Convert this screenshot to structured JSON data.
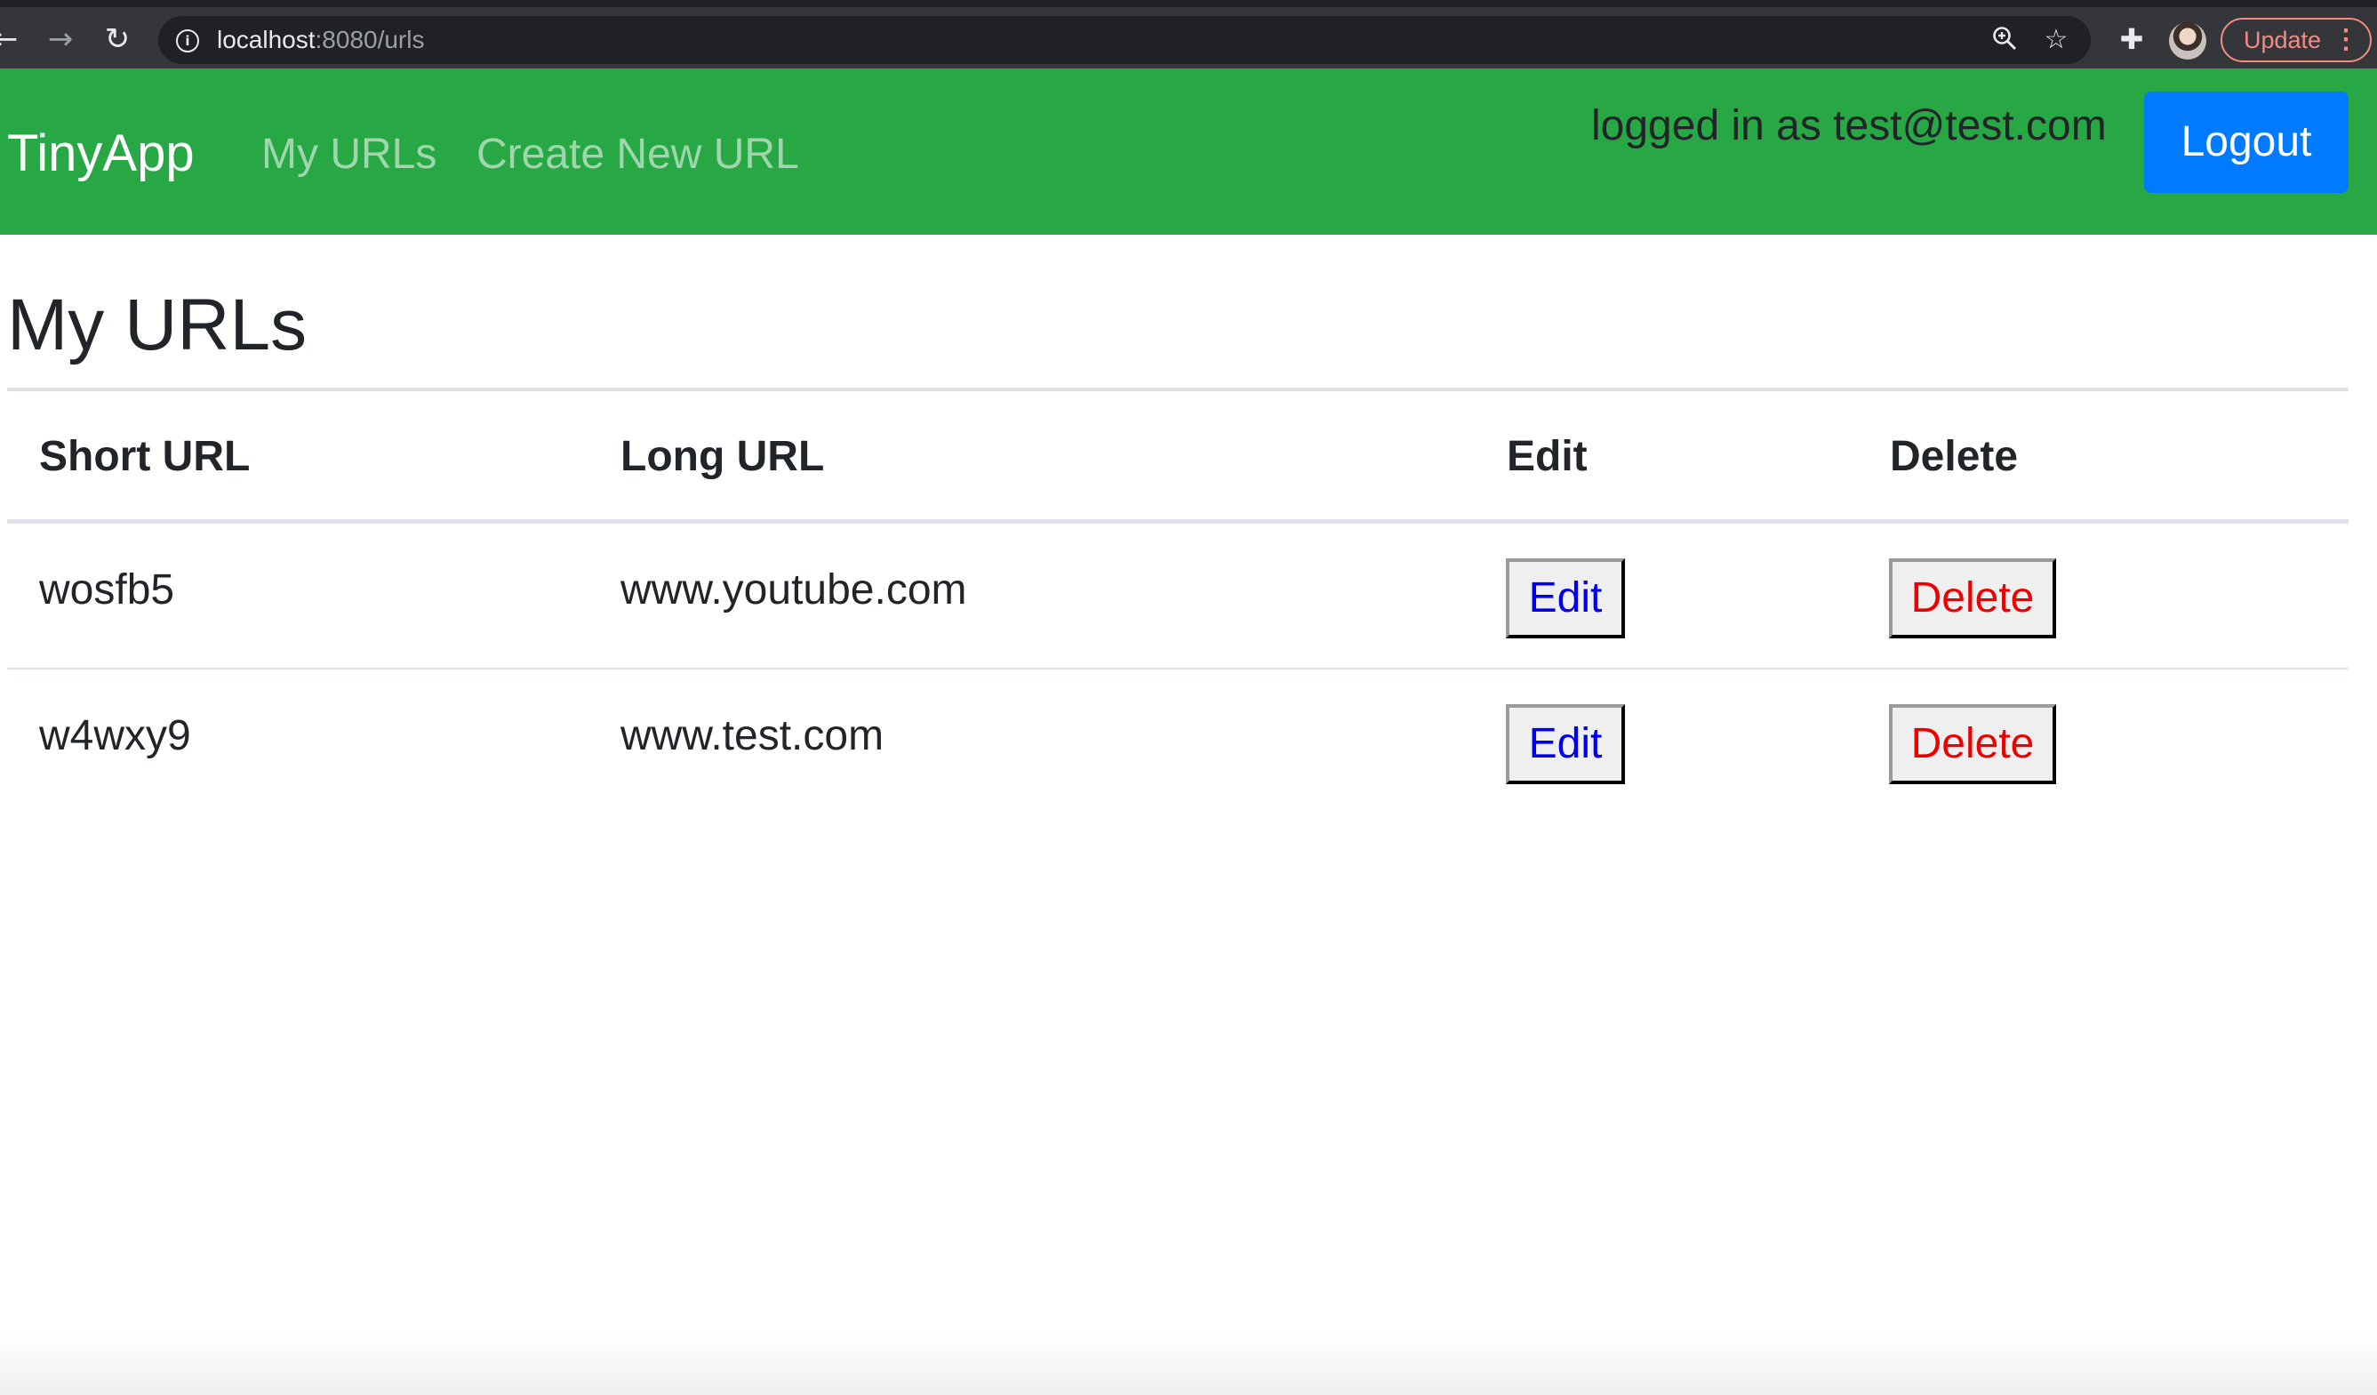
{
  "browser": {
    "url_host": "localhost",
    "url_path": ":8080/urls",
    "update_label": "Update",
    "icons": {
      "back": "back-arrow-icon",
      "forward": "forward-arrow-icon",
      "reload": "reload-icon",
      "info": "info-icon",
      "zoom": "zoom-icon",
      "bookmark": "star-icon",
      "extensions": "puzzle-icon",
      "menu": "kebab-menu-icon"
    }
  },
  "navbar": {
    "brand": "TinyApp",
    "links": [
      "My URLs",
      "Create New URL"
    ],
    "logged_in_text": "logged in as test@test.com",
    "logout_label": "Logout",
    "background_color": "#28a745",
    "logout_color": "#007bff"
  },
  "main": {
    "title": "My URLs",
    "table": {
      "headers": [
        "Short URL",
        "Long URL",
        "Edit",
        "Delete"
      ],
      "rows": [
        {
          "short": "wosfb5",
          "long": "www.youtube.com",
          "edit": "Edit",
          "delete": "Delete"
        },
        {
          "short": "w4wxy9",
          "long": "www.test.com",
          "edit": "Edit",
          "delete": "Delete"
        }
      ]
    }
  }
}
